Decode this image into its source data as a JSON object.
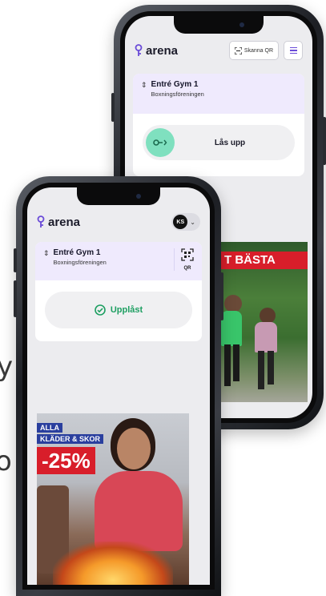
{
  "left_edge_glyphs": [
    "y",
    "o"
  ],
  "back_phone": {
    "logo": "arena",
    "scan_button": "Skanna QR",
    "door": {
      "title": "Entré Gym 1",
      "subtitle": "Boxningsföreningen"
    },
    "unlock_label": "Lås upp",
    "promo_banner": "T BÄSTA"
  },
  "front_phone": {
    "logo": "arena",
    "avatar_initials": "KS",
    "door": {
      "title": "Entré Gym 1",
      "subtitle": "Boxningsföreningen"
    },
    "qr_label": "QR",
    "status_label": "Upplåst",
    "promo": {
      "line1": "ALLA",
      "line2": "KLÄDER & SKOR",
      "discount": "-25%"
    }
  },
  "colors": {
    "brand_purple": "#6a4bd8",
    "card_header": "#efeafd",
    "success_green": "#1e9f62",
    "knob_green": "#7fe0bf",
    "promo_red": "#d81e2a",
    "promo_blue": "#2a3f9e"
  }
}
